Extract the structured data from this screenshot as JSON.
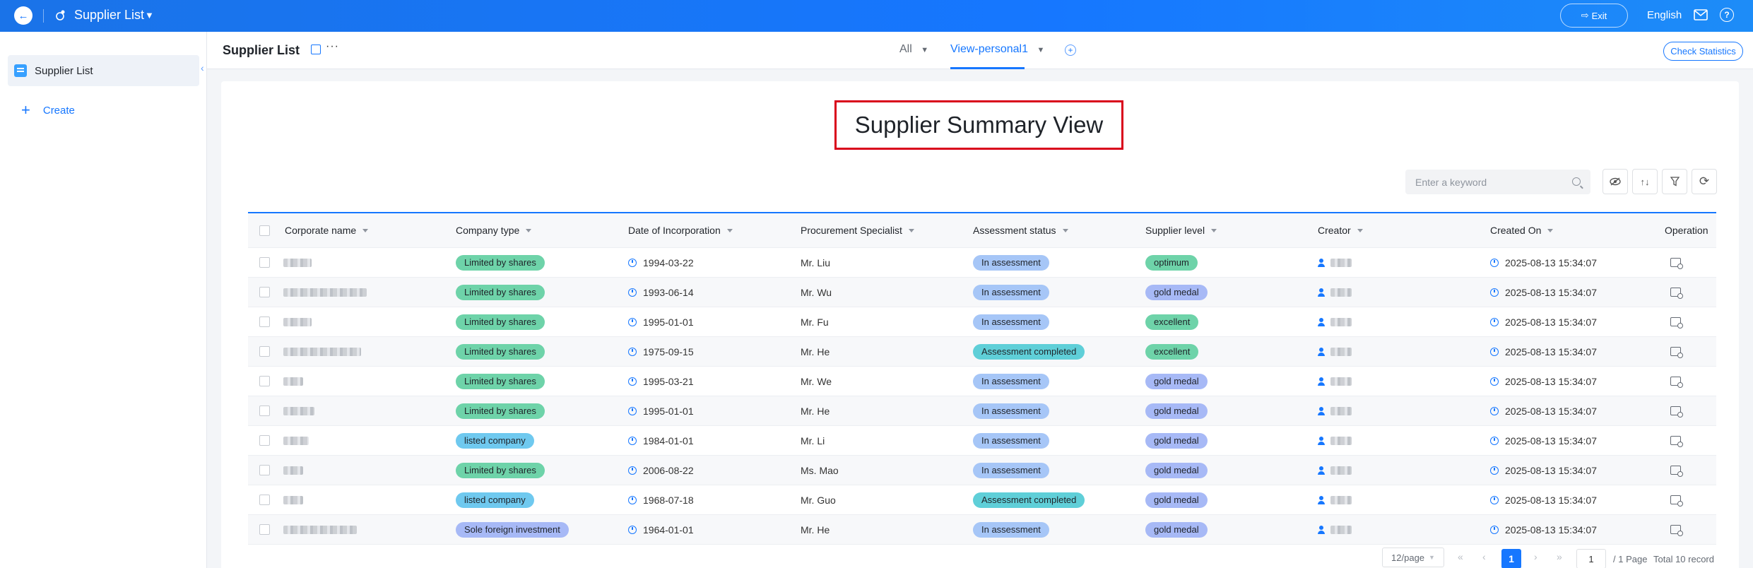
{
  "topbar": {
    "app_title": "Supplier List",
    "exit_label": "Exit",
    "language": "English"
  },
  "sidebar": {
    "items": [
      {
        "label": "Supplier List"
      }
    ],
    "create_label": "Create"
  },
  "header": {
    "page_title": "Supplier List",
    "tabs": [
      {
        "label": "All"
      },
      {
        "label": "View-personal1"
      }
    ],
    "check_statistics_label": "Check Statistics"
  },
  "view": {
    "title": "Supplier Summary View",
    "search_placeholder": "Enter a keyword"
  },
  "table": {
    "columns": [
      "Corporate name",
      "Company type",
      "Date of Incorporation",
      "Procurement Specialist",
      "Assessment status",
      "Supplier level",
      "Creator",
      "Created On",
      "Operation"
    ],
    "rows": [
      {
        "company_type": "Limited by shares",
        "date": "1994-03-22",
        "specialist": "Mr. Liu",
        "status": "In assessment",
        "level": "optimum",
        "created_on": "2025-08-13 15:34:07"
      },
      {
        "company_type": "Limited by shares",
        "date": "1993-06-14",
        "specialist": "Mr. Wu",
        "status": "In assessment",
        "level": "gold medal",
        "created_on": "2025-08-13 15:34:07"
      },
      {
        "company_type": "Limited by shares",
        "date": "1995-01-01",
        "specialist": "Mr. Fu",
        "status": "In assessment",
        "level": "excellent",
        "created_on": "2025-08-13 15:34:07"
      },
      {
        "company_type": "Limited by shares",
        "date": "1975-09-15",
        "specialist": "Mr. He",
        "status": "Assessment completed",
        "level": "excellent",
        "created_on": "2025-08-13 15:34:07"
      },
      {
        "company_type": "Limited by shares",
        "date": "1995-03-21",
        "specialist": "Mr. We",
        "status": "In assessment",
        "level": "gold medal",
        "created_on": "2025-08-13 15:34:07"
      },
      {
        "company_type": "Limited by shares",
        "date": "1995-01-01",
        "specialist": "Mr. He",
        "status": "In assessment",
        "level": "gold medal",
        "created_on": "2025-08-13 15:34:07"
      },
      {
        "company_type": "listed company",
        "date": "1984-01-01",
        "specialist": "Mr. Li",
        "status": "In assessment",
        "level": "gold medal",
        "created_on": "2025-08-13 15:34:07"
      },
      {
        "company_type": "Limited by shares",
        "date": "2006-08-22",
        "specialist": "Ms. Mao",
        "status": "In assessment",
        "level": "gold medal",
        "created_on": "2025-08-13 15:34:07"
      },
      {
        "company_type": "listed company",
        "date": "1968-07-18",
        "specialist": "Mr. Guo",
        "status": "Assessment completed",
        "level": "gold medal",
        "created_on": "2025-08-13 15:34:07"
      },
      {
        "company_type": "Sole foreign investment",
        "date": "1964-01-01",
        "specialist": "Mr. He",
        "status": "In assessment",
        "level": "gold medal",
        "created_on": "2025-08-13 15:34:07"
      }
    ]
  },
  "pagination": {
    "page_size": "12/page",
    "current_page": "1",
    "page_input": "1",
    "total_pages": "/ 1 Page",
    "total_records": "Total 10 record"
  },
  "colors": {
    "primary": "#1677ff",
    "highlight_box": "#d9001b",
    "badge_limited": "#6ed3a9",
    "badge_listed": "#6fc9ef",
    "badge_in_assessment": "#a6c6f7",
    "badge_completed": "#5fcfd8",
    "badge_gold": "#a7b9f6"
  },
  "icons": [
    "back-icon",
    "app-icon",
    "dropdown-caret-icon",
    "exit-icon",
    "mail-icon",
    "help-icon",
    "list-icon",
    "plus-icon",
    "edit-icon",
    "more-icon",
    "add-view-icon",
    "search-icon",
    "hide-columns-icon",
    "sort-icon",
    "filter-icon",
    "refresh-icon",
    "clock-icon",
    "person-icon",
    "detail-icon"
  ]
}
